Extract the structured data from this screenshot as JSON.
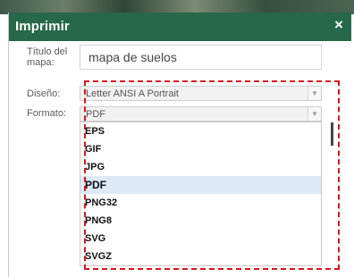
{
  "dialog": {
    "title": "Imprimir",
    "close_symbol": "×",
    "map_title_label": "Título del mapa:",
    "map_title_value": "mapa de suelos",
    "design_label": "Diseño:",
    "design_value": "Letter ANSI A Portrait",
    "format_label": "Formato:",
    "format_value": "PDF",
    "dropdown_arrow": "▼",
    "format_options": [
      "EPS",
      "GIF",
      "JPG",
      "PDF",
      "PNG32",
      "PNG8",
      "SVG",
      "SVGZ"
    ],
    "selected_option": "PDF"
  },
  "colors": {
    "header": "#27674a",
    "highlight": "#d8141b",
    "selected_bg": "#dde9f7"
  }
}
